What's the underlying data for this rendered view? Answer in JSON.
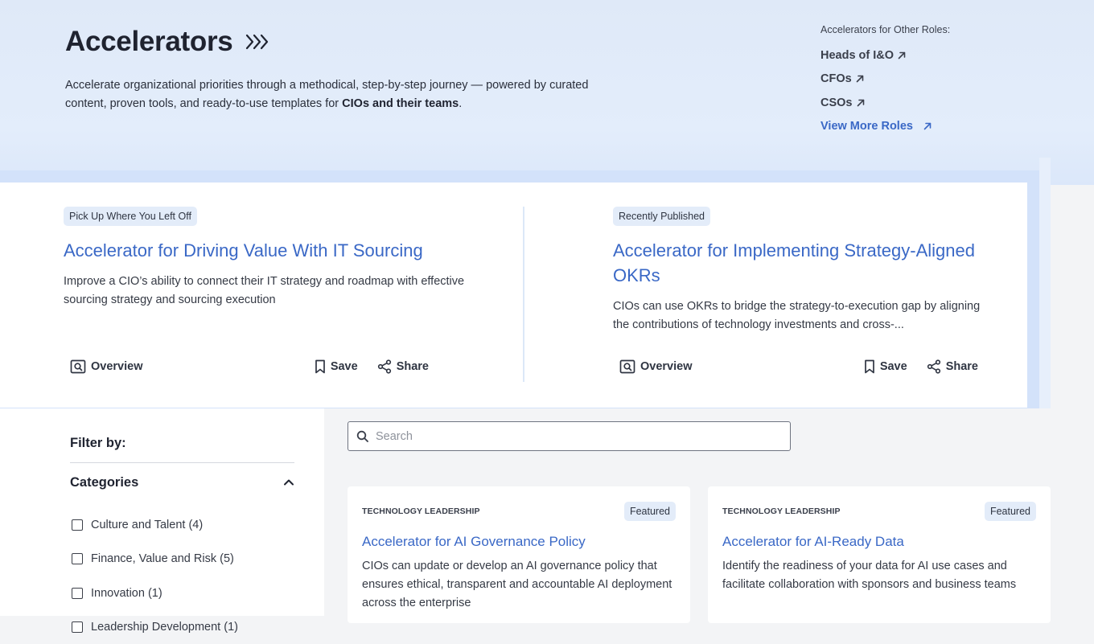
{
  "hero": {
    "title": "Accelerators",
    "description_pre": "Accelerate organizational priorities through a methodical, step-by-step journey — powered by curated content, proven tools, and ready-to-use templates for ",
    "description_bold": "CIOs and their teams",
    "description_post": "."
  },
  "roles": {
    "heading": "Accelerators for Other Roles:",
    "links": [
      "Heads of I&O",
      "CFOs",
      "CSOs"
    ],
    "more_label": "View More Roles"
  },
  "featured": [
    {
      "tag": "Pick Up Where You Left Off",
      "title": "Accelerator for Driving Value With IT Sourcing",
      "description": "Improve a CIO’s ability to connect their IT strategy and roadmap with effective sourcing strategy and sourcing execution",
      "overview_label": "Overview",
      "save_label": "Save",
      "share_label": "Share"
    },
    {
      "tag": "Recently Published",
      "title": "Accelerator for Implementing Strategy-Aligned OKRs",
      "description": "CIOs can use OKRs to bridge the strategy-to-execution gap by aligning the contributions of technology investments and cross-...",
      "overview_label": "Overview",
      "save_label": "Save",
      "share_label": "Share"
    }
  ],
  "sidebar": {
    "filter_label": "Filter by:",
    "categories_label": "Categories",
    "categories": [
      "Culture and Talent (4)",
      "Finance, Value and Risk (5)",
      "Innovation (1)",
      "Leadership Development (1)"
    ]
  },
  "search": {
    "placeholder": "Search"
  },
  "results": [
    {
      "category": "TECHNOLOGY LEADERSHIP",
      "badge": "Featured",
      "title": "Accelerator for AI Governance Policy",
      "description": "CIOs can update or develop an AI governance policy that ensures ethical, transparent and accountable AI deployment across the enterprise"
    },
    {
      "category": "TECHNOLOGY LEADERSHIP",
      "badge": "Featured",
      "title": "Accelerator for AI-Ready Data",
      "description": "Identify the readiness of your data for AI use cases and facilitate collaboration with sponsors and business teams"
    }
  ],
  "colors": {
    "link_blue": "#3a68c6",
    "hero_bg": "#e0eaf9",
    "pill_bg": "#e3ecf9"
  }
}
